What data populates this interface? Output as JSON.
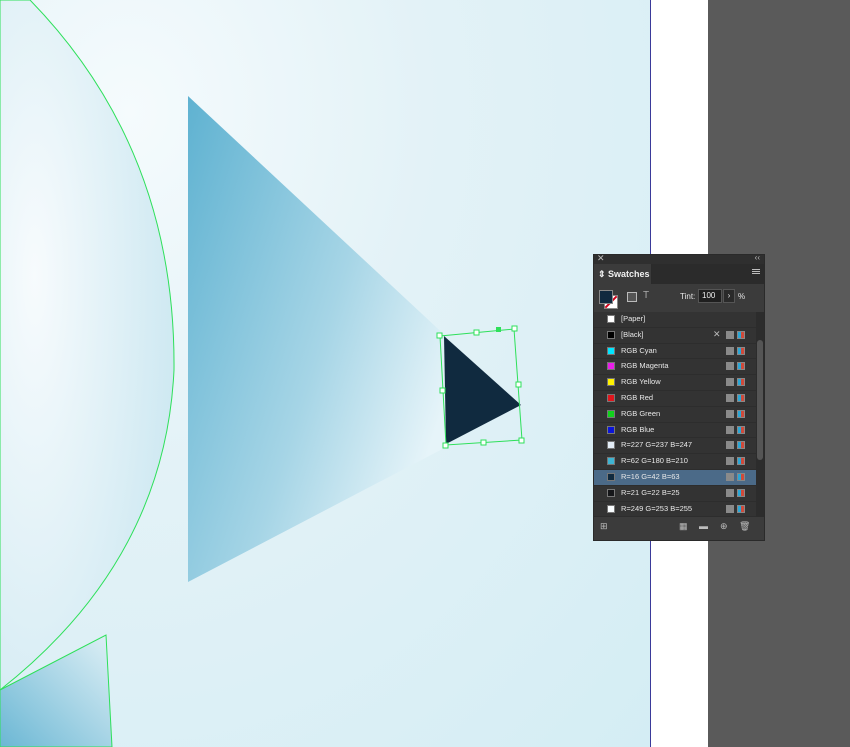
{
  "panel": {
    "title": "Swatches",
    "tint_label": "Tint:",
    "tint_value": "100",
    "tint_unit": "%",
    "close_glyph": "✕",
    "collapse_glyph": "‹‹",
    "swatches": [
      {
        "name": "[Paper]",
        "color": "#ffffff",
        "selected": false
      },
      {
        "name": "[Black]",
        "color": "#000000",
        "selected": false
      },
      {
        "name": "RGB Cyan",
        "color": "#00e5ff",
        "selected": false
      },
      {
        "name": "RGB Magenta",
        "color": "#e91ee9",
        "selected": false
      },
      {
        "name": "RGB Yellow",
        "color": "#fff200",
        "selected": false
      },
      {
        "name": "RGB Red",
        "color": "#e0151c",
        "selected": false
      },
      {
        "name": "RGB Green",
        "color": "#10d21b",
        "selected": false
      },
      {
        "name": "RGB Blue",
        "color": "#0a14d9",
        "selected": false
      },
      {
        "name": "R=227 G=237 B=247",
        "color": "#e3edf7",
        "selected": false
      },
      {
        "name": "R=62 G=180 B=210",
        "color": "#3eb4d2",
        "selected": false
      },
      {
        "name": "R=16 G=42 B=63",
        "color": "#102a3f",
        "selected": true
      },
      {
        "name": "R=21 G=22 B=25",
        "color": "#151619",
        "selected": false
      },
      {
        "name": "R=249 G=253 B=255",
        "color": "#f9fdff",
        "selected": false
      }
    ]
  },
  "colors": {
    "selection": "#2ee05a",
    "dark_triangle": "#102a3f",
    "page_edge": "#3a3a9a"
  }
}
